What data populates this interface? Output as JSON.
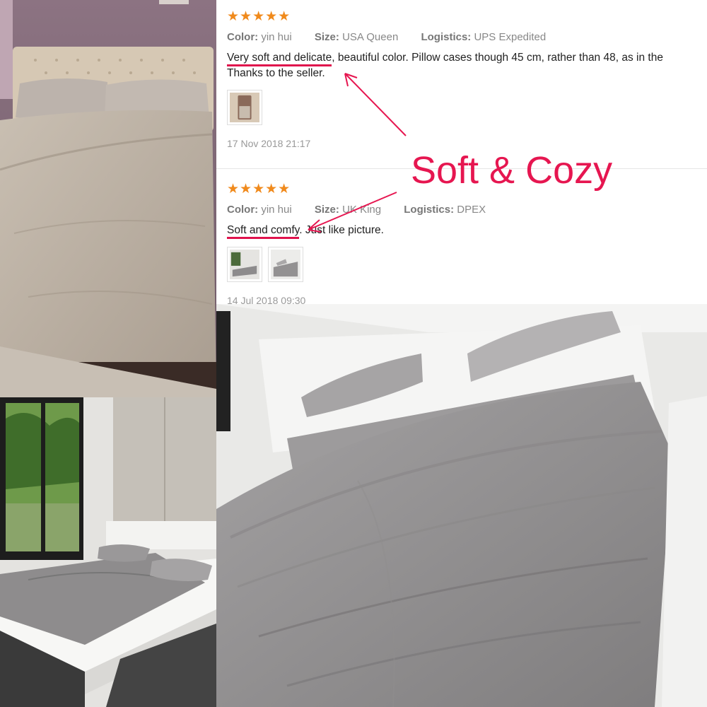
{
  "reviews": [
    {
      "stars": "★★★★★",
      "color_label": "Color:",
      "color_value": "yin hui",
      "size_label": "Size:",
      "size_value": "USA Queen",
      "logistics_label": "Logistics:",
      "logistics_value": "UPS Expedited",
      "text_highlight": "Very soft and delicate",
      "text_rest": ", beautiful color. Pillow cases though 45 cm, rather than 48, as in the",
      "text_line2": "Thanks to the seller.",
      "date": "17 Nov 2018 21:17"
    },
    {
      "stars": "★★★★★",
      "color_label": "Color:",
      "color_value": "yin hui",
      "size_label": "Size:",
      "size_value": "UK King",
      "logistics_label": "Logistics:",
      "logistics_value": "DPEX",
      "text_highlight": "Soft and comfy",
      "text_rest": ". Just like picture.",
      "date": "14 Jul 2018 09:30"
    }
  ],
  "callout": "Soft & Cozy",
  "colors": {
    "accent": "#e61650",
    "stars": "#f08a1c"
  }
}
